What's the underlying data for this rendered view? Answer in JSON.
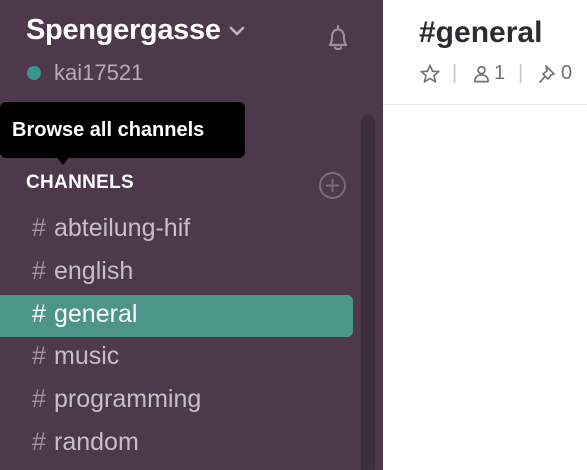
{
  "sidebar": {
    "team_name": "Spengergasse",
    "username": "kai17521",
    "tooltip": "Browse all channels",
    "channels_header": "CHANNELS",
    "channels": [
      {
        "hash": "#",
        "name": "abteilung-hif",
        "active": false
      },
      {
        "hash": "#",
        "name": "english",
        "active": false
      },
      {
        "hash": "#",
        "name": "general",
        "active": true
      },
      {
        "hash": "#",
        "name": "music",
        "active": false
      },
      {
        "hash": "#",
        "name": "programming",
        "active": false
      },
      {
        "hash": "#",
        "name": "random",
        "active": false
      }
    ]
  },
  "header": {
    "channel_title": "#general",
    "member_count": "1",
    "pinned_count": "0",
    "separator": "|"
  },
  "icons": {
    "team_menu": "chevron-down-icon",
    "notifications": "bell-icon",
    "add_channel": "plus-circle-icon",
    "star": "star-icon",
    "members": "person-icon",
    "pins": "pin-icon"
  },
  "colors": {
    "sidebar_bg": "#4d394b",
    "active_channel": "#4c9689",
    "presence": "#38978d",
    "tooltip_bg": "#000000"
  }
}
